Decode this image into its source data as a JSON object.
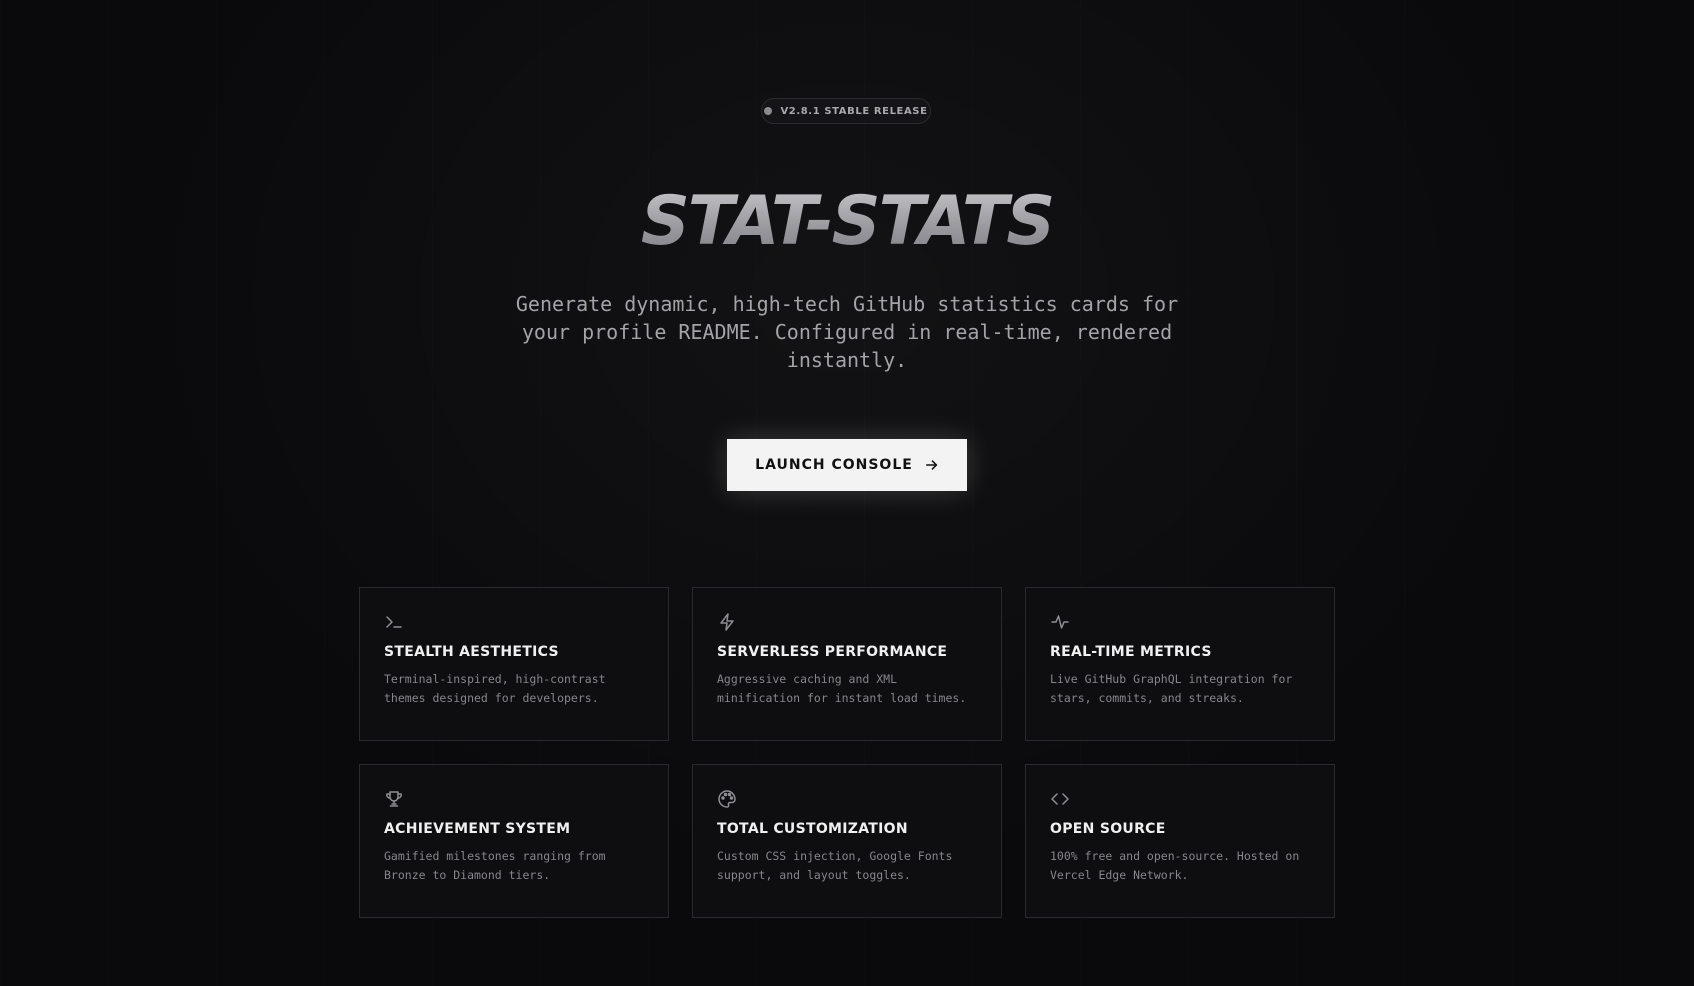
{
  "badge": {
    "text": "V2.8.1 STABLE RELEASE"
  },
  "hero": {
    "title": "STAT-STATS",
    "subtitle": "Generate dynamic, high-tech GitHub statistics cards for your profile README. Configured in real-time, rendered instantly."
  },
  "cta": {
    "label": "LAUNCH CONSOLE",
    "icon": "arrow-right-icon"
  },
  "features": [
    {
      "icon": "terminal-icon",
      "title": "STEALTH AESTHETICS",
      "desc": "Terminal-inspired, high-contrast themes designed for developers."
    },
    {
      "icon": "lightning-icon",
      "title": "SERVERLESS PERFORMANCE",
      "desc": "Aggressive caching and XML minification for instant load times."
    },
    {
      "icon": "activity-icon",
      "title": "REAL-TIME METRICS",
      "desc": "Live GitHub GraphQL integration for stars, commits, and streaks."
    },
    {
      "icon": "trophy-icon",
      "title": "ACHIEVEMENT SYSTEM",
      "desc": "Gamified milestones ranging from Bronze to Diamond tiers."
    },
    {
      "icon": "palette-icon",
      "title": "TOTAL CUSTOMIZATION",
      "desc": "Custom CSS injection, Google Fonts support, and layout toggles."
    },
    {
      "icon": "code-icon",
      "title": "OPEN SOURCE",
      "desc": "100% free and open-source. Hosted on Vercel Edge Network."
    }
  ],
  "colors": {
    "background": "#0a0a0c",
    "card_border": "#2a2a2e",
    "cta_background": "#f3f3f3"
  }
}
